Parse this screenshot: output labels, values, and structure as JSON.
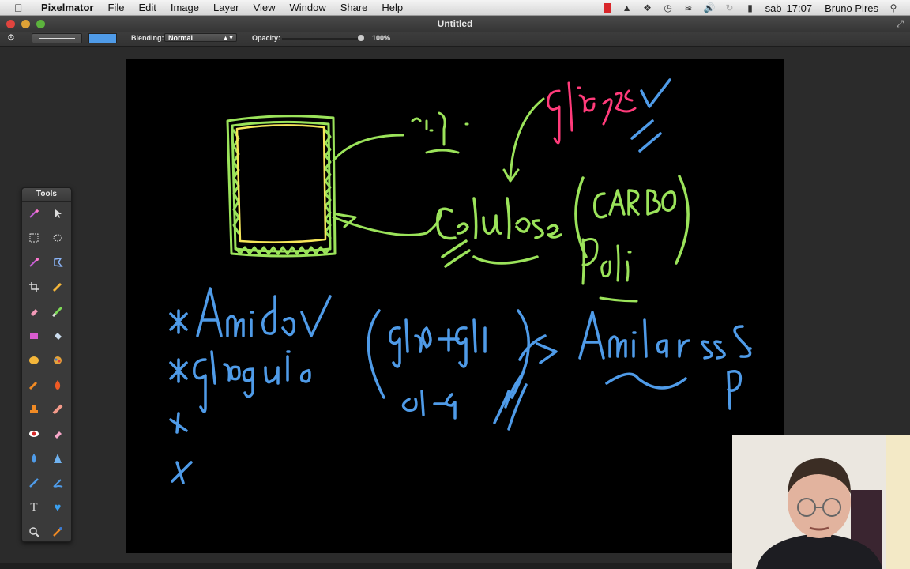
{
  "menubar": {
    "app_name": "Pixelmator",
    "items": [
      "File",
      "Edit",
      "Image",
      "Layer",
      "View",
      "Window",
      "Share",
      "Help"
    ],
    "status_day": "sab",
    "status_time": "17:07",
    "user": "Bruno Pires",
    "status_icons": [
      "red-flag-icon",
      "adobe-icon",
      "dropbox-icon",
      "timemachine-icon",
      "wifi-icon",
      "volume-icon",
      "sync-icon",
      "battery-icon",
      "search-icon"
    ]
  },
  "window": {
    "title": "Untitled"
  },
  "options": {
    "blending_label": "Blending:",
    "blending_value": "Normal",
    "opacity_label": "Opacity:",
    "opacity_value": "100%",
    "brush_color": "#4f9be8",
    "opacity_level": 1.0
  },
  "tools": {
    "title": "Tools",
    "items": [
      "magic-wand-icon",
      "arrow-icon",
      "rect-select-icon",
      "ellipse-select-icon",
      "eyedropper-select-icon",
      "lasso-icon",
      "crop-icon",
      "pencil-icon",
      "eraser-icon",
      "brush-icon",
      "rectangle-shape-icon",
      "paint-bucket-icon",
      "ellipse-shape-icon",
      "color-picker-icon",
      "smudge-icon",
      "burn-icon",
      "stamp-icon",
      "healing-icon",
      "red-eye-icon",
      "eraser-pink-icon",
      "blur-icon",
      "sharpen-icon",
      "pen-icon",
      "freeform-pen-icon",
      "type-icon",
      "custom-shape-icon",
      "zoom-icon",
      "eyedropper-icon"
    ]
  },
  "colors": {
    "green": "#9be35a",
    "yellow": "#f6e65a",
    "pink": "#ff3b7a",
    "blue": "#4f9be8"
  }
}
